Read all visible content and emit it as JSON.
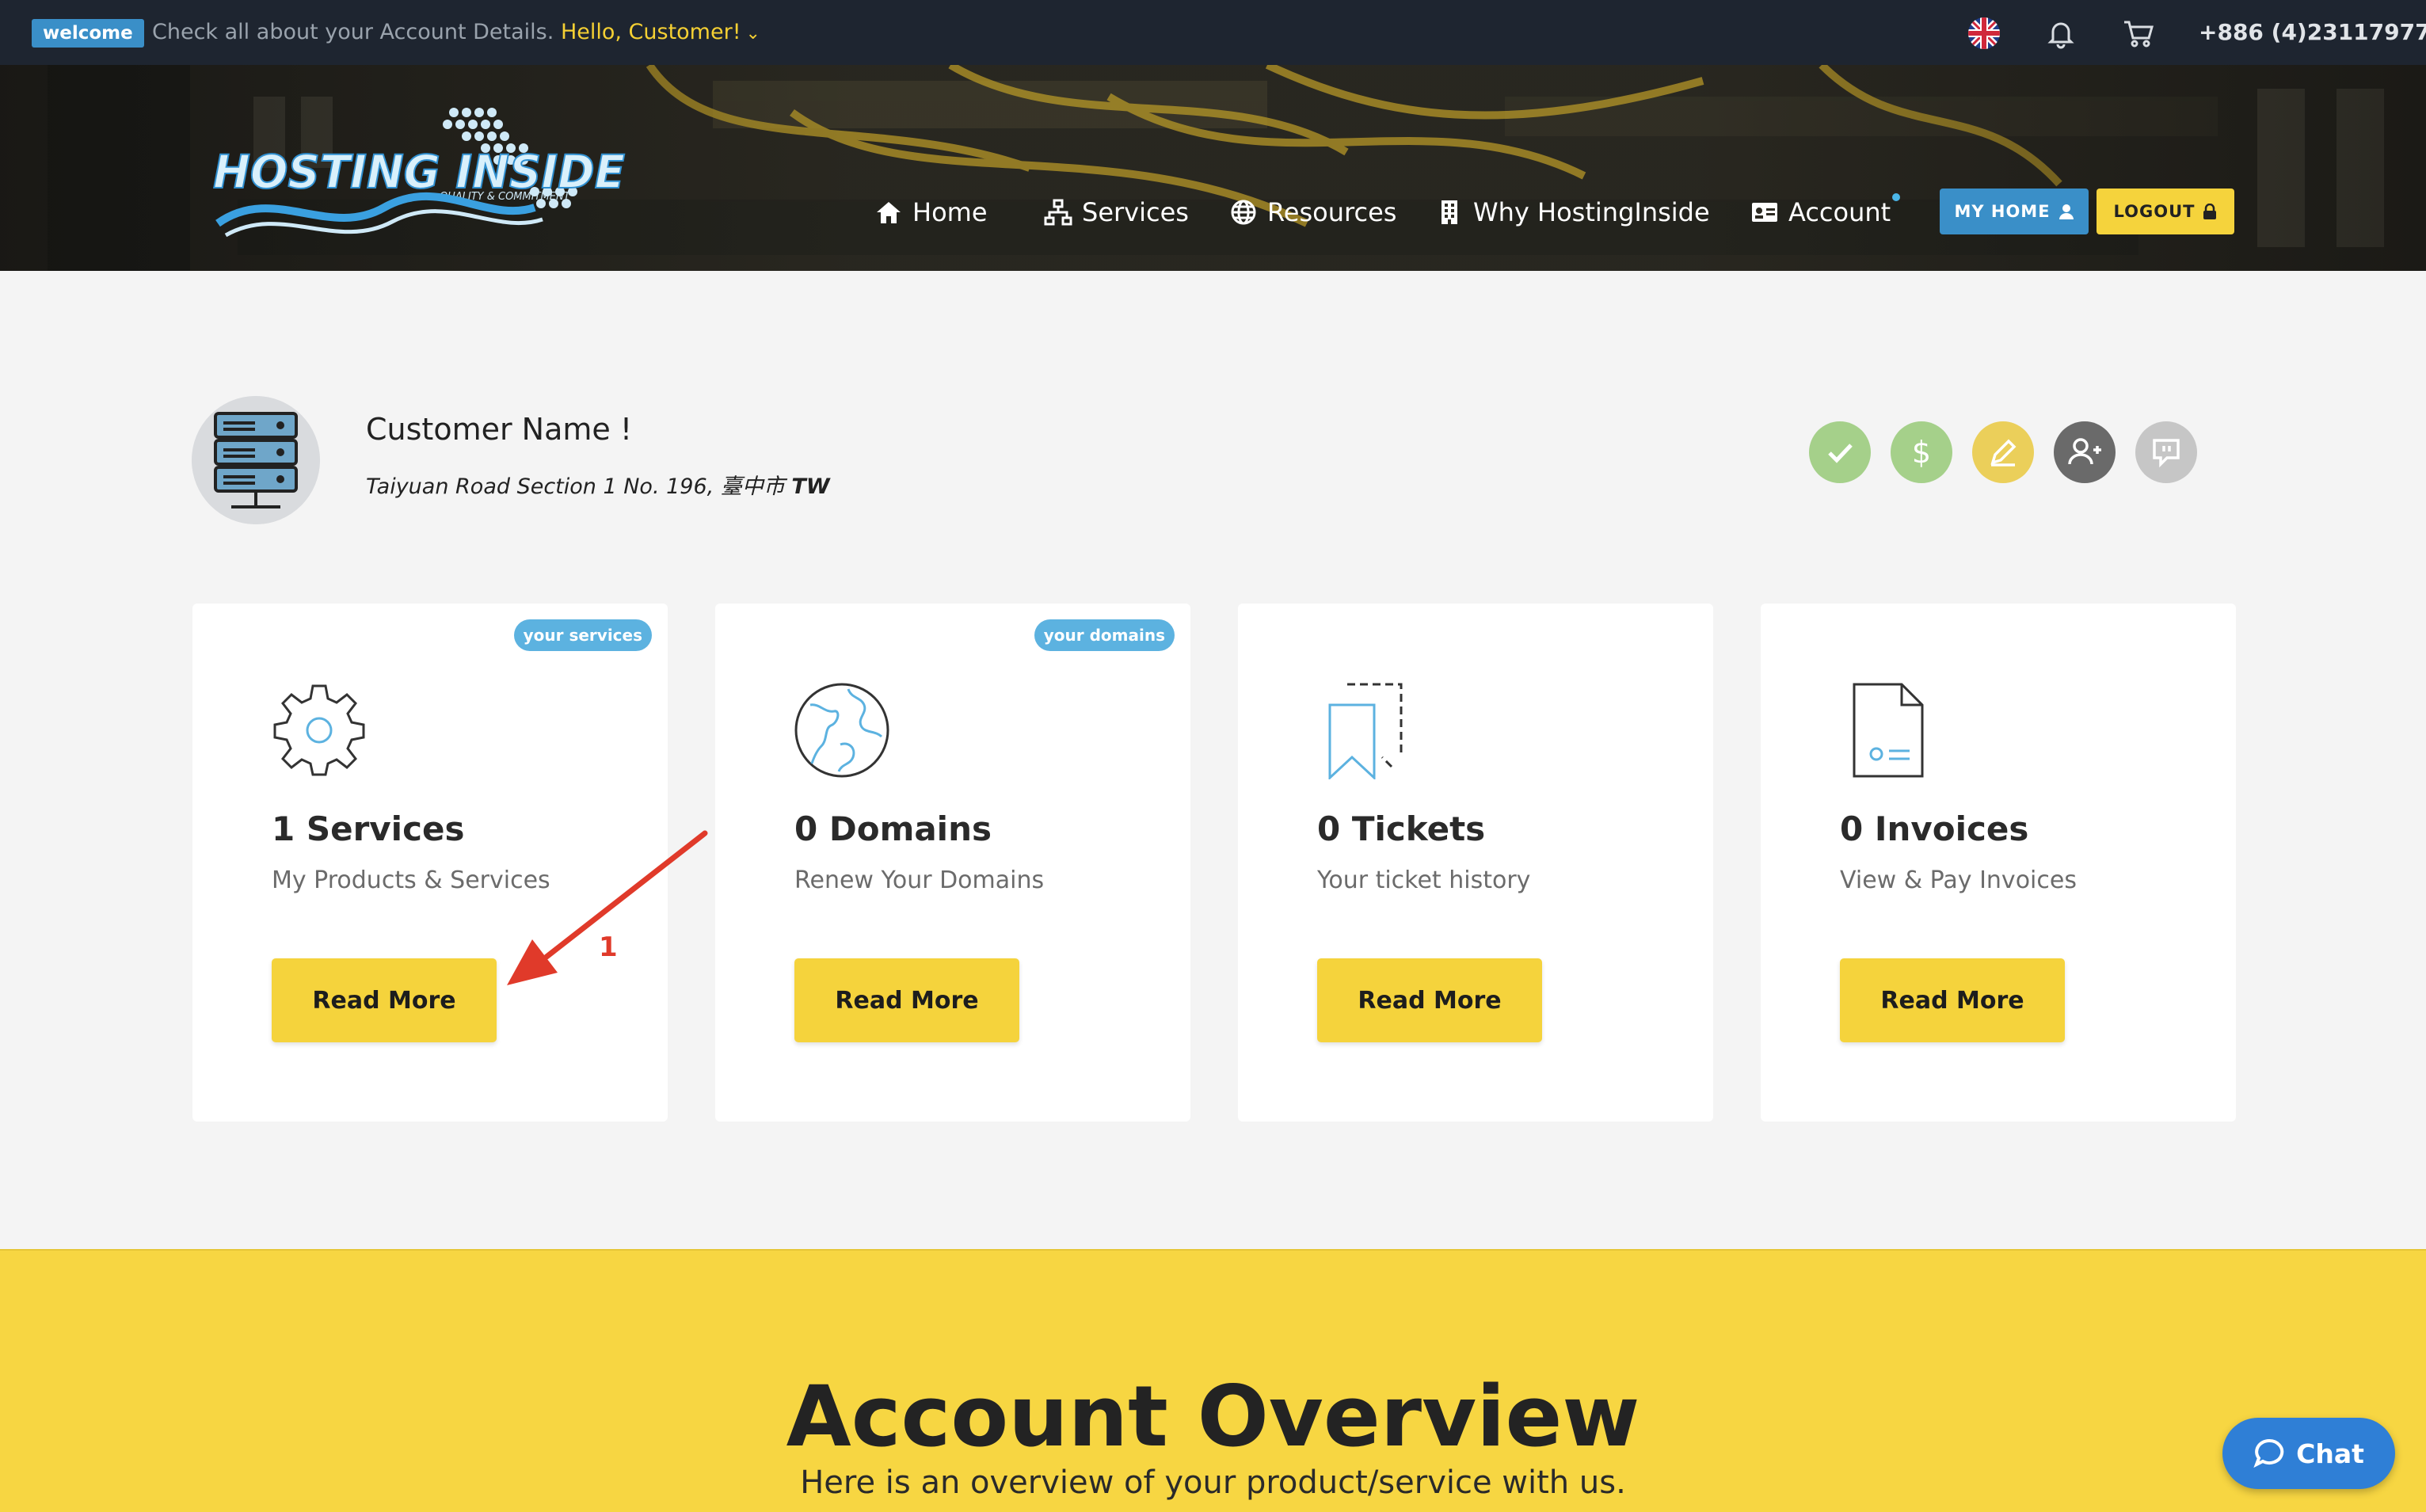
{
  "topbar": {
    "welcome_badge": "welcome",
    "message": "Check all about your Account Details.",
    "hello": "Hello, Customer!",
    "phone": "+886 (4)23117977"
  },
  "header": {
    "logo_text": "HOSTING INSIDE",
    "logo_tagline": "QUALITY & COMMITMENT",
    "nav": [
      {
        "label": "Home",
        "icon": "home-icon"
      },
      {
        "label": "Services",
        "icon": "sitemap-icon"
      },
      {
        "label": "Resources",
        "icon": "globe-icon"
      },
      {
        "label": "Why HostingInside",
        "icon": "building-icon"
      },
      {
        "label": "Account",
        "icon": "id-card-icon"
      }
    ],
    "my_home_label": "MY HOME",
    "logout_label": "LOGOUT"
  },
  "profile": {
    "name": "Customer Name !",
    "address": "Taiyuan Road Section 1 No. 196, 臺中市",
    "country": "TW",
    "actions": [
      {
        "name": "verified-icon",
        "color": "#a5d08a"
      },
      {
        "name": "billing-icon",
        "color": "#a5d08a"
      },
      {
        "name": "edit-icon",
        "color": "#ebcf5a"
      },
      {
        "name": "add-contact-icon",
        "color": "#6a6a6a"
      },
      {
        "name": "message-icon",
        "color": "#c6c6c6"
      }
    ]
  },
  "cards": [
    {
      "badge": "your services",
      "title": "1 Services",
      "subtitle": "My Products & Services",
      "button": "Read More",
      "icon": "gear-icon"
    },
    {
      "badge": "your domains",
      "title": "0 Domains",
      "subtitle": "Renew Your Domains",
      "button": "Read More",
      "icon": "globe-icon"
    },
    {
      "badge": "",
      "title": "0 Tickets",
      "subtitle": "Your ticket history",
      "button": "Read More",
      "icon": "ticket-icon"
    },
    {
      "badge": "",
      "title": "0 Invoices",
      "subtitle": "View & Pay Invoices",
      "button": "Read More",
      "icon": "invoice-icon"
    }
  ],
  "annotation": {
    "label": "1",
    "color": "#e03a2a"
  },
  "overview": {
    "title": "Account Overview",
    "subtitle": "Here is an overview of your product/service with us."
  },
  "chat": {
    "label": "Chat"
  },
  "colors": {
    "accent_yellow": "#f5d33c",
    "accent_blue": "#3a8fc8",
    "topbar_bg": "#1e2530"
  }
}
